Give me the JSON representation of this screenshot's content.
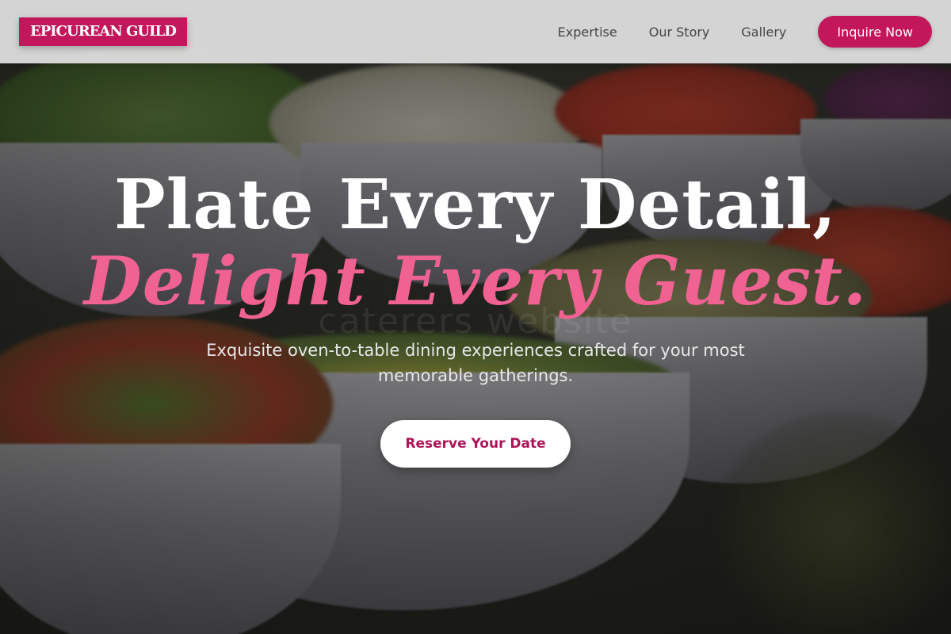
{
  "nav": {
    "logo": "EPICUREAN GUILD",
    "links": [
      "Expertise",
      "Our Story",
      "Gallery"
    ],
    "cta": "Inquire Now"
  },
  "hero": {
    "headline_line1": "Plate Every Detail,",
    "headline_line2": "Delight Every Guest.",
    "ghost_text": "caterers website",
    "subtitle": "Exquisite oven-to-table dining experiences crafted for your most memorable gatherings.",
    "button": "Reserve Your Date",
    "background_image": "bowls-of-fresh-salads-photo"
  },
  "colors": {
    "brand": "#c2185b",
    "accent_pink": "#f06292",
    "button_text": "#ad1457",
    "nav_bg": "#e2e2e2"
  }
}
